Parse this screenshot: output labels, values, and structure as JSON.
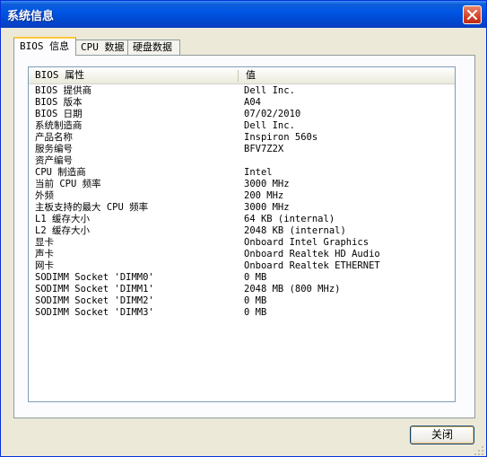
{
  "window": {
    "title": "系统信息",
    "close_button_label": "关闭"
  },
  "tabs": [
    {
      "label": "BIOS 信息",
      "active": true
    },
    {
      "label": "CPU 数据",
      "active": false
    },
    {
      "label": "硬盘数据",
      "active": false
    }
  ],
  "table": {
    "columns": [
      "BIOS 属性",
      "值"
    ],
    "rows": [
      [
        "BIOS 提供商",
        "Dell Inc."
      ],
      [
        "BIOS 版本",
        "A04"
      ],
      [
        "BIOS 日期",
        "07/02/2010"
      ],
      [
        "系统制造商",
        "Dell Inc."
      ],
      [
        "产品名称",
        "Inspiron 560s"
      ],
      [
        "服务编号",
        "BFV7Z2X"
      ],
      [
        "资产编号",
        ""
      ],
      [
        "CPU 制造商",
        "Intel"
      ],
      [
        "当前 CPU 频率",
        "3000 MHz"
      ],
      [
        "外频",
        "200 MHz"
      ],
      [
        "主板支持的最大 CPU 频率",
        "3000 MHz"
      ],
      [
        "L1 缓存大小",
        "64 KB (internal)"
      ],
      [
        "L2 缓存大小",
        "2048 KB (internal)"
      ],
      [
        "显卡",
        "Onboard Intel Graphics"
      ],
      [
        "声卡",
        "Onboard Realtek HD Audio"
      ],
      [
        "网卡",
        "Onboard Realtek ETHERNET"
      ],
      [
        "SODIMM Socket 'DIMM0'",
        "0 MB"
      ],
      [
        "SODIMM Socket 'DIMM1'",
        "2048 MB (800 MHz)"
      ],
      [
        "SODIMM Socket 'DIMM2'",
        "0 MB"
      ],
      [
        "SODIMM Socket 'DIMM3'",
        "0 MB"
      ]
    ]
  },
  "icons": {
    "close": "close-icon",
    "grip": "resize-grip-icon"
  }
}
